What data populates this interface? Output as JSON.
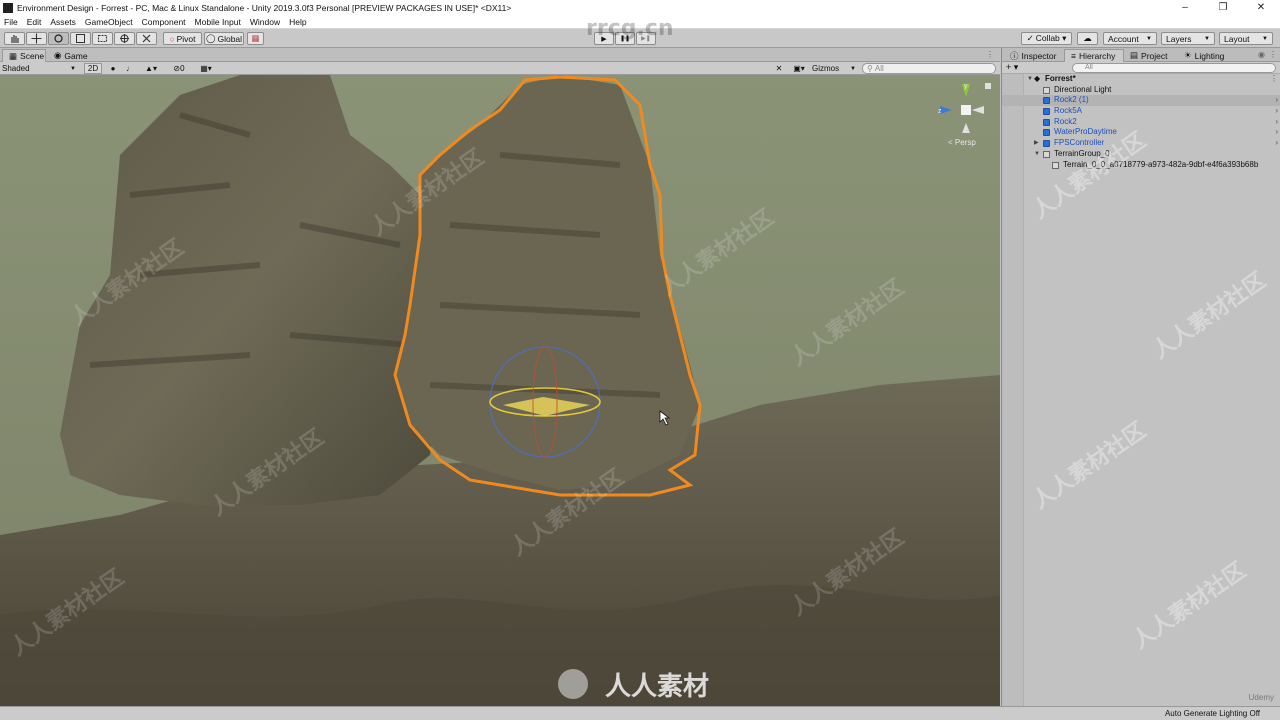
{
  "window": {
    "title": "Environment Design - Forrest - PC, Mac & Linux Standalone - Unity 2019.3.0f3 Personal [PREVIEW PACKAGES IN USE]* <DX11>",
    "controls": [
      "–",
      "❐",
      "✕"
    ]
  },
  "menu": [
    "File",
    "Edit",
    "Assets",
    "GameObject",
    "Component",
    "Mobile Input",
    "Window",
    "Help"
  ],
  "toolbar": {
    "pivot_label": "Pivot",
    "global_label": "Global",
    "play_icon": "▶",
    "pause_icon": "❚❚",
    "step_icon": "▶❚",
    "collab_label": "Collab ▾",
    "account_label": "Account",
    "layers_label": "Layers",
    "layout_label": "Layout",
    "watermark": "rrcg.cn"
  },
  "scene_tabs": {
    "scene": "Scene",
    "game": "Game"
  },
  "scene_bar": {
    "shading_mode": "Shaded",
    "mode_2d": "2D",
    "hidden_count": "0",
    "gizmos_label": "Gizmos",
    "search_placeholder": "All"
  },
  "viewport": {
    "gizmo_y": "y",
    "gizmo_z": "z",
    "gizmo_persp": "< Persp",
    "overlay_logo_text": "人人素材",
    "watermark_text": "人人素材社区",
    "udemy": "Udemy"
  },
  "right_tabs": {
    "inspector": "Inspector",
    "hierarchy": "Hierarchy",
    "project": "Project",
    "lighting": "Lighting"
  },
  "hierarchy": {
    "add_label": "+ ▾",
    "search_placeholder": "All",
    "items": [
      {
        "label": "Forrest*",
        "depth": 0,
        "expanded": true,
        "kind": "scene"
      },
      {
        "label": "Directional Light",
        "depth": 1,
        "kind": "object"
      },
      {
        "label": "Rock2 (1)",
        "depth": 1,
        "kind": "prefab",
        "selected": true
      },
      {
        "label": "Rock5A",
        "depth": 1,
        "kind": "prefab"
      },
      {
        "label": "Rock2",
        "depth": 1,
        "kind": "prefab"
      },
      {
        "label": "WaterProDaytime",
        "depth": 1,
        "kind": "prefab"
      },
      {
        "label": "FPSController",
        "depth": 1,
        "kind": "prefab",
        "collapsed": true
      },
      {
        "label": "TerrainGroup_0",
        "depth": 1,
        "kind": "object",
        "expanded": true
      },
      {
        "label": "Terrain_0_0_a0718779-a973-482a-9dbf-e4f6a393b68b",
        "depth": 2,
        "kind": "object"
      }
    ]
  },
  "status": {
    "text": "Auto Generate Lighting Off"
  },
  "colors": {
    "selection_outline": "#f08a1f",
    "prefab_blue": "#1d4fb8",
    "fog": "#8c9478"
  }
}
